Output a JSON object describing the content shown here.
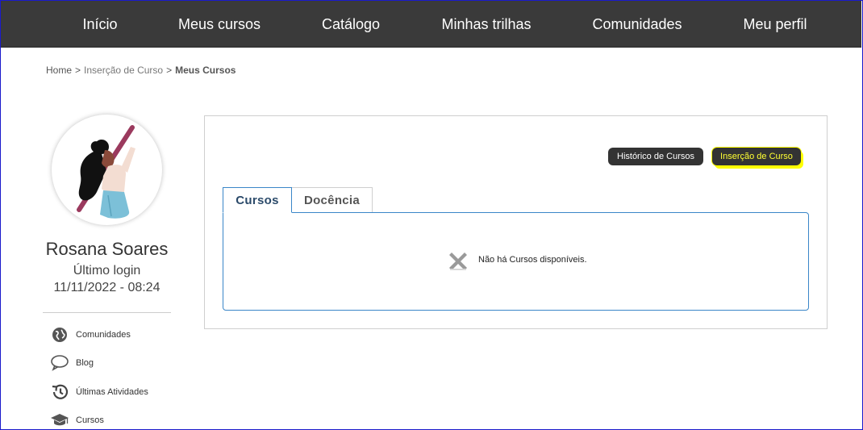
{
  "nav": {
    "items": [
      {
        "label": "Início"
      },
      {
        "label": "Meus cursos"
      },
      {
        "label": "Catálogo"
      },
      {
        "label": "Minhas trilhas"
      },
      {
        "label": "Comunidades"
      },
      {
        "label": "Meu perfil"
      }
    ]
  },
  "breadcrumb": {
    "home": "Home",
    "sep": ">",
    "middle": "Inserção de Curso",
    "current": "Meus Cursos"
  },
  "profile": {
    "name": "Rosana Soares",
    "last_login_label": "Último login",
    "last_login_value": "11/11/2022 - 08:24"
  },
  "sidebar": {
    "items": [
      {
        "label": "Comunidades",
        "icon": "globe-icon"
      },
      {
        "label": "Blog",
        "icon": "speech-bubble-icon"
      },
      {
        "label": "Últimas Atividades",
        "icon": "history-icon"
      },
      {
        "label": "Cursos",
        "icon": "graduation-cap-icon"
      }
    ]
  },
  "actions": {
    "history_label": "Histórico de Cursos",
    "insert_label": "Inserção de Curso"
  },
  "tabs": [
    {
      "label": "Cursos",
      "active": true
    },
    {
      "label": "Docência",
      "active": false
    }
  ],
  "empty_state": {
    "icon": "x-icon",
    "message": "Não há Cursos disponíveis."
  },
  "colors": {
    "nav_bg": "#3a3a3a",
    "highlight": "#ffff00",
    "tab_border": "#3a86c8"
  }
}
